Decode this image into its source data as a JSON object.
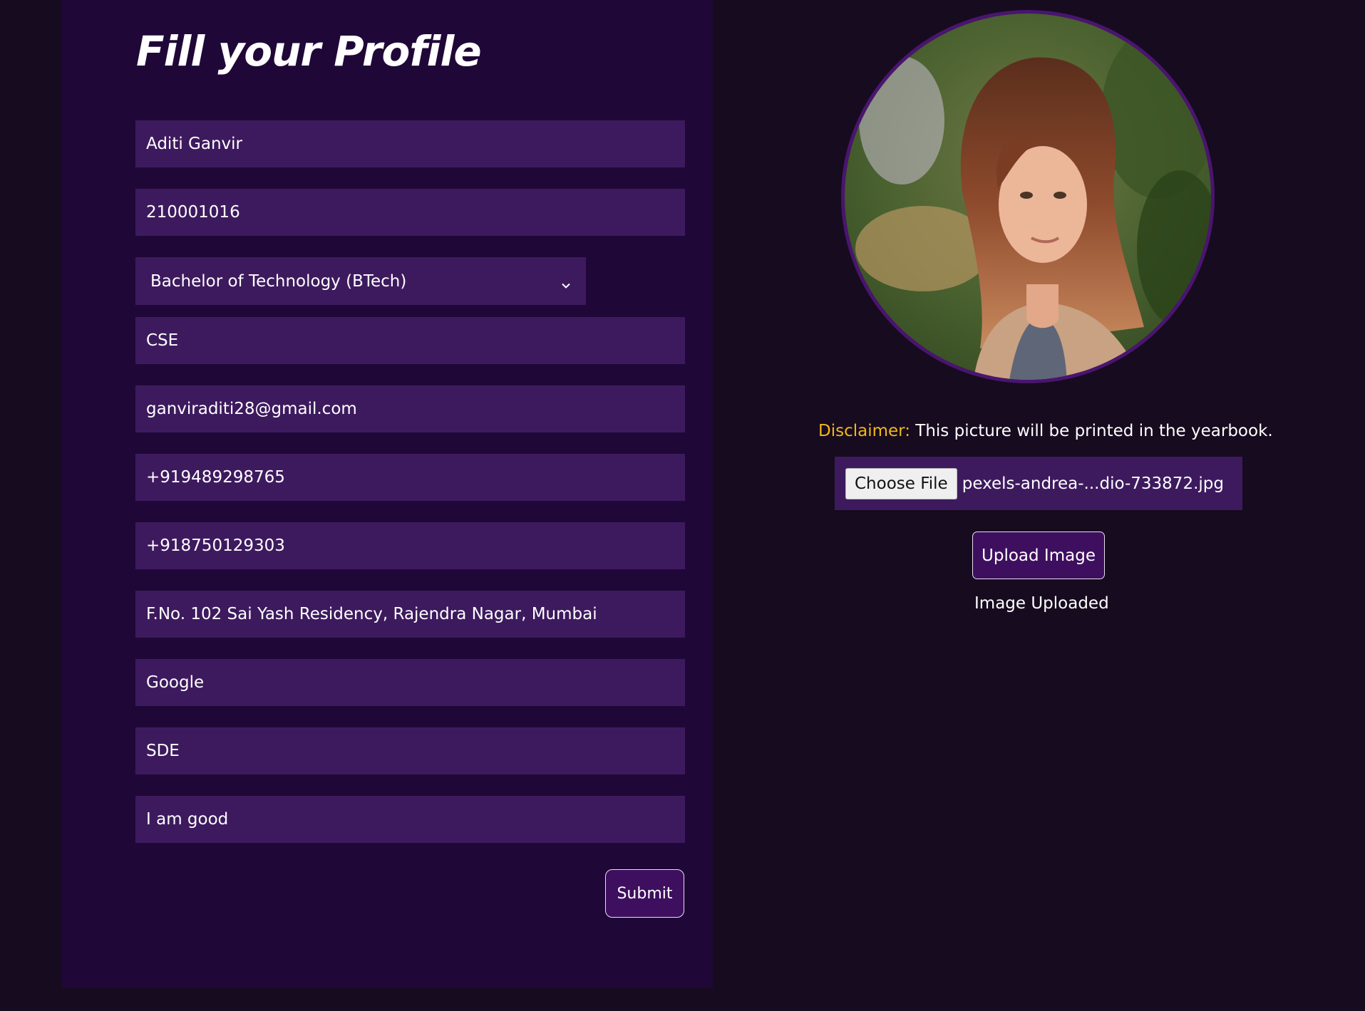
{
  "form": {
    "title": "Fill your Profile",
    "name": "Aditi Ganvir",
    "roll_number": "210001016",
    "degree": "Bachelor of Technology (BTech)",
    "branch": "CSE",
    "email": "ganviraditi28@gmail.com",
    "phone": "+919489298765",
    "alt_phone": "+918750129303",
    "address": "F.No. 102 Sai Yash Residency, Rajendra Nagar, Mumbai",
    "company": "Google",
    "role": "SDE",
    "about": "I am good",
    "submit_label": "Submit"
  },
  "profile_image": {
    "disclaimer_label": "Disclaimer:",
    "disclaimer_text": " This picture will be printed in the yearbook.",
    "choose_file_label": "Choose File",
    "file_name": "pexels-andrea-...dio-733872.jpg",
    "upload_label": "Upload Image",
    "status_text": "Image Uploaded"
  },
  "colors": {
    "page_background": "#170b1f",
    "panel_background": "#1f0837",
    "field_background": "#3d1a5e",
    "button_background": "#3e0f5f",
    "disclaimer_accent": "#f2b81a"
  },
  "icons": {
    "select_arrow": "chevron-down-icon"
  }
}
